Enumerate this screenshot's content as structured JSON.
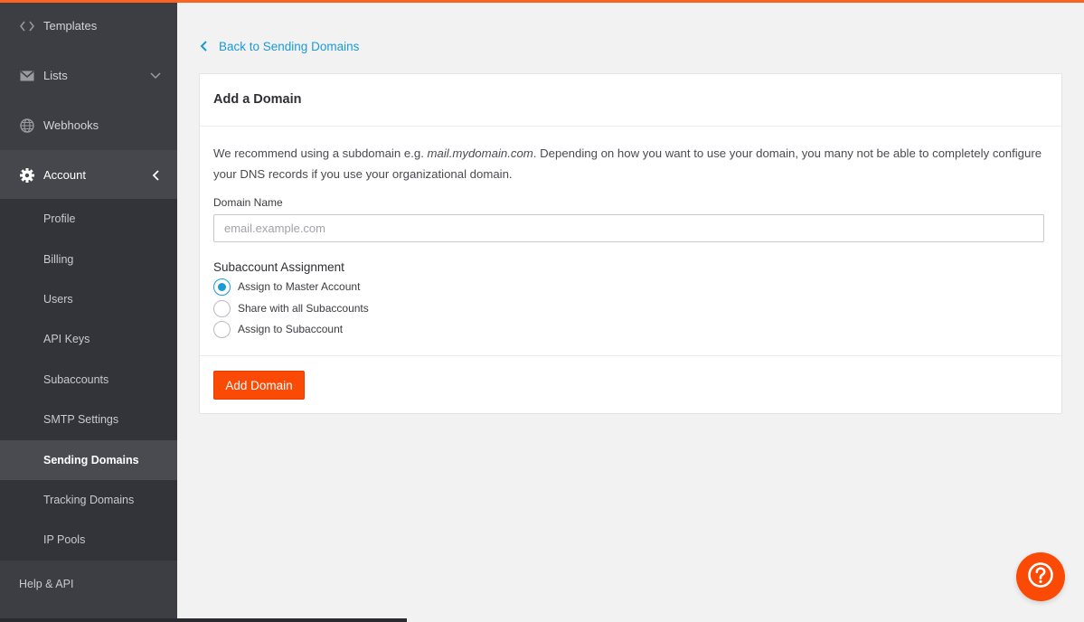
{
  "sidebar": {
    "templates": {
      "label": "Templates",
      "icon": "code-brackets-icon"
    },
    "lists": {
      "label": "Lists",
      "icon": "envelope-icon"
    },
    "webhooks": {
      "label": "Webhooks",
      "icon": "globe-icon"
    },
    "account": {
      "label": "Account",
      "icon": "gear-icon"
    },
    "account_submenu": [
      {
        "label": "Profile"
      },
      {
        "label": "Billing"
      },
      {
        "label": "Users"
      },
      {
        "label": "API Keys"
      },
      {
        "label": "Subaccounts"
      },
      {
        "label": "SMTP Settings"
      },
      {
        "label": "Sending Domains",
        "active": true
      },
      {
        "label": "Tracking Domains"
      },
      {
        "label": "IP Pools"
      }
    ],
    "help": {
      "label": "Help & API"
    }
  },
  "main": {
    "back_link": "Back to Sending Domains",
    "card_title": "Add a Domain",
    "intro_pre": "We recommend using a subdomain e.g. ",
    "intro_example": "mail.mydomain.com",
    "intro_post": ". Depending on how you want to use your domain, you many not be able to completely configure your DNS records if you use your organizational domain.",
    "domain_label": "Domain Name",
    "domain_placeholder": "email.example.com",
    "domain_value": "",
    "subaccount_label": "Subaccount Assignment",
    "radio_options": [
      {
        "label": "Assign to Master Account",
        "checked": true
      },
      {
        "label": "Share with all Subaccounts",
        "checked": false
      },
      {
        "label": "Assign to Subaccount",
        "checked": false
      }
    ],
    "submit_label": "Add Domain"
  },
  "colors": {
    "accent_orange": "#fa4a06",
    "link_blue": "#1a9ad6",
    "sidebar_bg": "#3d3e44"
  },
  "help_fab_icon": "question-circle-icon"
}
